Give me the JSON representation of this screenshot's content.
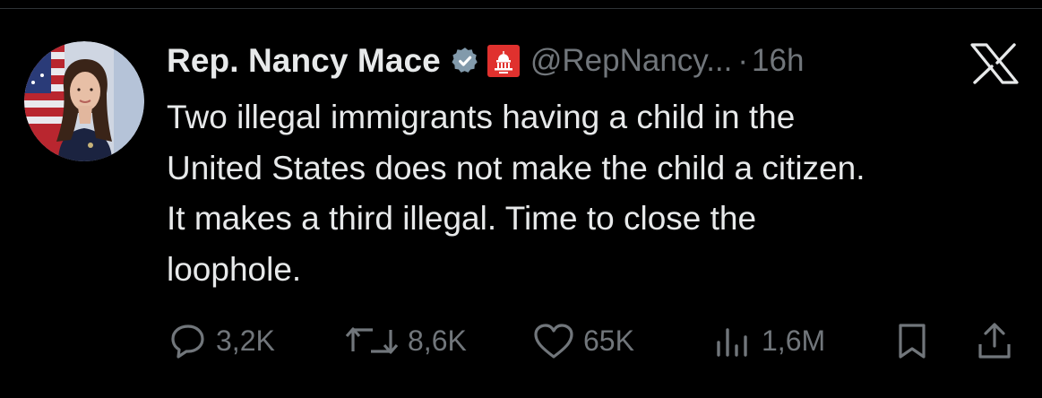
{
  "author": {
    "display_name": "Rep. Nancy Mace",
    "handle": "@RepNancy...",
    "separator": "·",
    "timestamp": "16h"
  },
  "tweet": {
    "text": "Two illegal immigrants having a child in the\nUnited States does not make the child a citizen.\nIt makes a third illegal. Time to close the\nloophole."
  },
  "metrics": {
    "replies": "3,2K",
    "retweets": "8,6K",
    "likes": "65K",
    "views": "1,6M"
  },
  "icons": {
    "verified": "verified-badge-icon",
    "affiliation": "house-gop-badge-icon",
    "platform": "x-logo-icon",
    "reply": "reply-icon",
    "retweet": "retweet-icon",
    "like": "like-icon",
    "views": "views-icon",
    "bookmark": "bookmark-icon",
    "share": "share-icon"
  },
  "colors": {
    "background": "#000000",
    "text": "#e7e9ea",
    "secondary": "#71767b",
    "verified_badge": "#829aab",
    "affiliation_badge": "#e0312e"
  }
}
